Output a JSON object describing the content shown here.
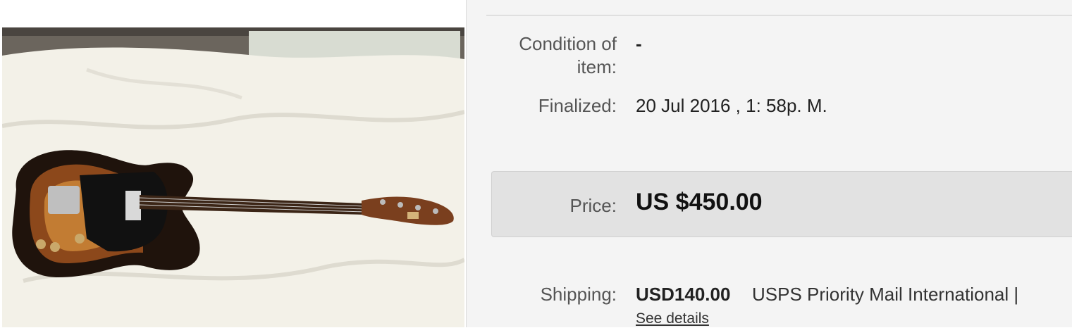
{
  "details": {
    "condition": {
      "label": "Condition of item:",
      "value": "-"
    },
    "finalized": {
      "label": "Finalized:",
      "value": "20 Jul 2016 , 1: 58p. M."
    },
    "price": {
      "label": "Price:",
      "value": "US $450.00"
    },
    "shipping": {
      "label": "Shipping:",
      "cost": "USD140.00",
      "service": "USPS Priority Mail International |",
      "link": "See details"
    }
  },
  "colors": {
    "panel_bg": "#f4f4f4",
    "price_box_bg": "#e2e2e2"
  }
}
